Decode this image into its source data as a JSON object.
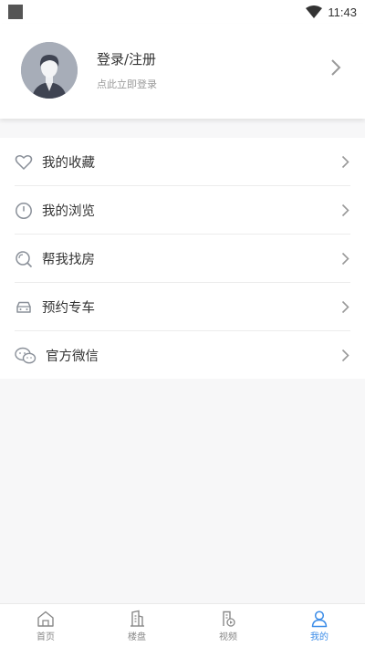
{
  "status": {
    "time": "11:43"
  },
  "profile": {
    "title": "登录/注册",
    "subtitle": "点此立即登录"
  },
  "menu": [
    {
      "label": "我的收藏",
      "icon": "heart-icon"
    },
    {
      "label": "我的浏览",
      "icon": "clock-icon"
    },
    {
      "label": "帮我找房",
      "icon": "search-icon"
    },
    {
      "label": "预约专车",
      "icon": "car-icon"
    },
    {
      "label": "官方微信",
      "icon": "wechat-icon"
    }
  ],
  "tabs": [
    {
      "label": "首页",
      "icon": "home-icon",
      "active": false
    },
    {
      "label": "楼盘",
      "icon": "building-icon",
      "active": false
    },
    {
      "label": "视频",
      "icon": "video-icon",
      "active": false
    },
    {
      "label": "我的",
      "icon": "user-icon",
      "active": true
    }
  ],
  "colors": {
    "accent": "#3c8de8",
    "icon_gray": "#8a9099"
  }
}
